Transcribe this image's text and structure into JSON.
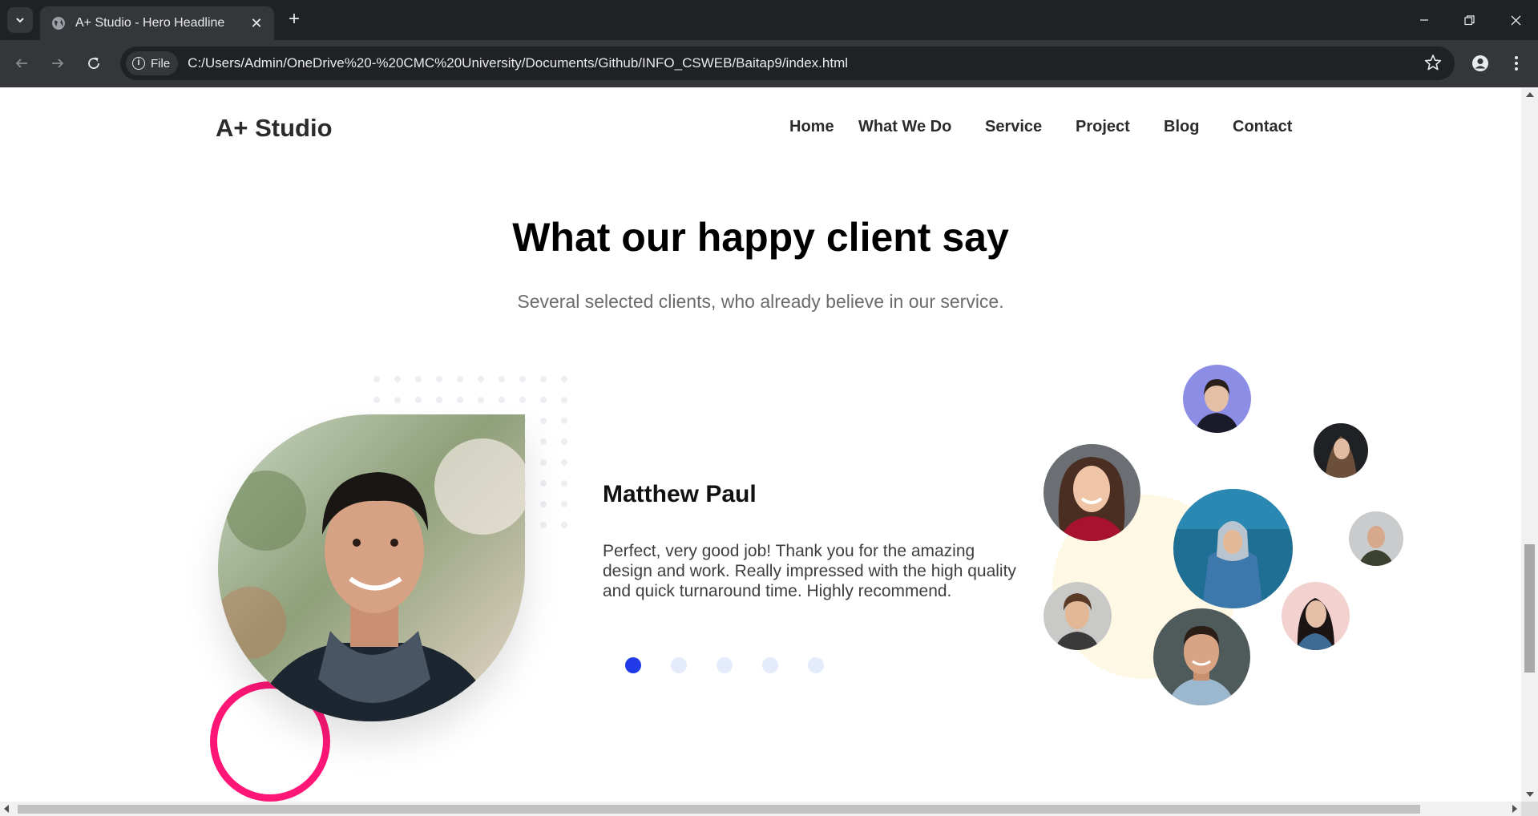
{
  "browser": {
    "tab_title": "A+ Studio - Hero Headline",
    "file_chip": "File",
    "url": "C:/Users/Admin/OneDrive%20-%20CMC%20University/Documents/Github/INFO_CSWEB/Baitap9/index.html"
  },
  "site": {
    "brand": "A+ Studio",
    "nav": [
      "Home",
      "What We Do",
      "Service",
      "Project",
      "Blog",
      "Contact"
    ]
  },
  "testimonials": {
    "title": "What our happy client say",
    "subtitle": "Several selected clients, who already believe in our service.",
    "active": {
      "name": "Matthew Paul",
      "quote": "Perfect, very good job! Thank you for the amazing design and work. Really impressed with the high quality and quick turnaround time. Highly recommend."
    },
    "pager_count": 5,
    "pager_active": 1
  },
  "colors": {
    "accent_pink": "#ff1677",
    "pager_active": "#1f3ae6",
    "pager_inactive": "#e4ebfb",
    "blob_yellow": "#fff8e4"
  }
}
